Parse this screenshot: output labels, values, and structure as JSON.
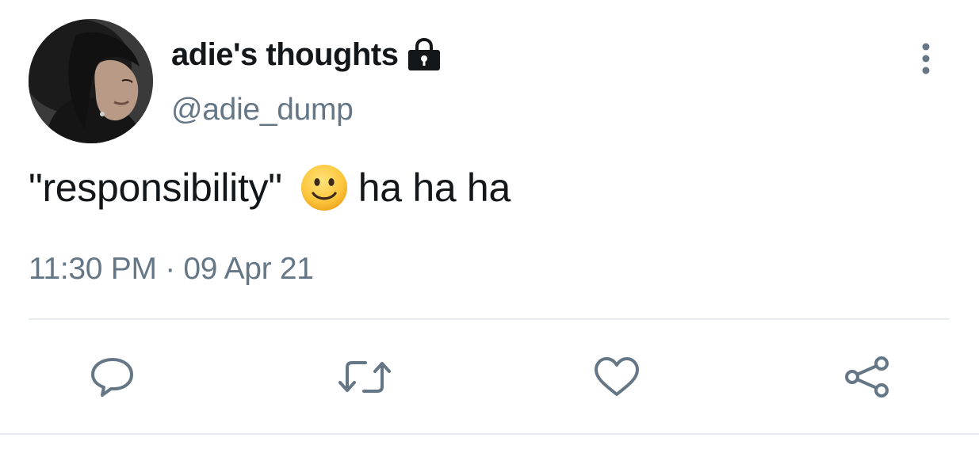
{
  "tweet": {
    "display_name": "adie's thoughts",
    "handle": "@adie_dump",
    "text_before": "\"responsibility\"",
    "text_after": "ha ha ha",
    "time": "11:30 PM",
    "separator": "·",
    "date": "09 Apr 21",
    "emoji": "slightly-smiling-face",
    "protected": true
  },
  "colors": {
    "text_primary": "#14171a",
    "text_secondary": "#657786",
    "icon": "#657786",
    "divider": "#e6ecf0"
  },
  "actions": [
    {
      "name": "reply",
      "icon": "speech-bubble-icon"
    },
    {
      "name": "retweet",
      "icon": "retweet-icon"
    },
    {
      "name": "like",
      "icon": "heart-icon"
    },
    {
      "name": "share",
      "icon": "share-icon"
    }
  ]
}
